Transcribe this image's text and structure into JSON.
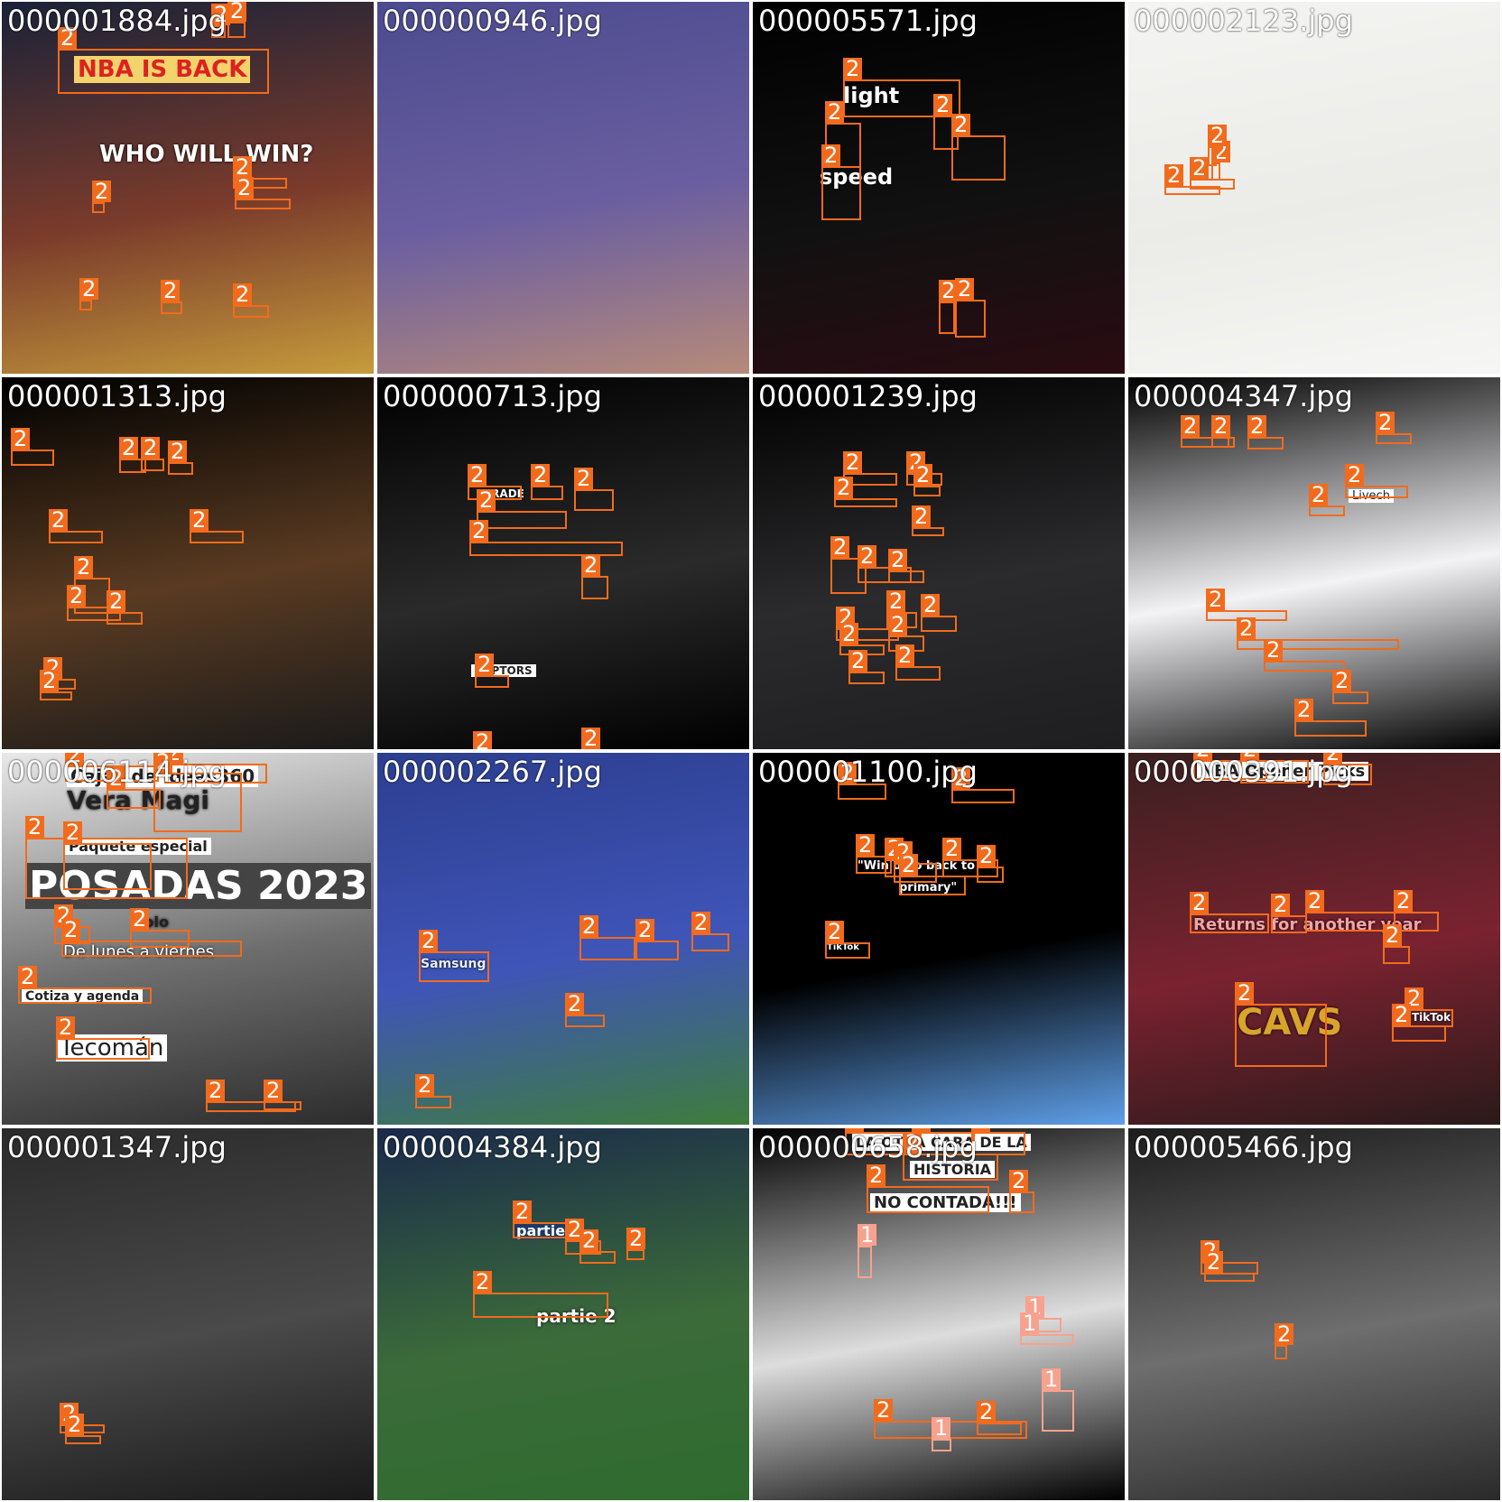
{
  "tiles": [
    {
      "file": "000001884.jpg",
      "bg": [
        "#1b2238",
        "#7a3b2b",
        "#c69b3c"
      ],
      "texts": [
        "NBA IS BACK",
        "WHO WILL WIN?"
      ]
    },
    {
      "file": "000000946.jpg",
      "bg": [
        "#4b4b8f",
        "#6b5fa0",
        "#b68a7a"
      ],
      "texts": []
    },
    {
      "file": "000005571.jpg",
      "bg": [
        "#000000",
        "#111111",
        "#2a0c12"
      ],
      "texts": [
        "light",
        "speed"
      ]
    },
    {
      "file": "000002123.jpg",
      "bg": [
        "#f4f4f2",
        "#ebebe8",
        "#f6f6f4"
      ],
      "texts": []
    },
    {
      "file": "000001313.jpg",
      "bg": [
        "#000000",
        "#5a3b22",
        "#1a1a1a"
      ],
      "texts": []
    },
    {
      "file": "000000713.jpg",
      "bg": [
        "#000000",
        "#2a2a2a",
        "#000000"
      ],
      "texts": [
        "TRADE",
        "RAPTORS"
      ]
    },
    {
      "file": "000001239.jpg",
      "bg": [
        "#000000",
        "#2b2b2d",
        "#1e1e20"
      ],
      "texts": []
    },
    {
      "file": "000004347.jpg",
      "bg": [
        "#000000",
        "#f3f3f6",
        "#000000"
      ],
      "texts": [
        "Livech"
      ]
    },
    {
      "file": "000006114.jpg",
      "bg": [
        "#e9e9e9",
        "#6e6e6e",
        "#2c2c2c"
      ],
      "texts": [
        "Cajas de ideas360",
        "Vera Magi",
        "Paquete especial",
        "POSADAS 2023",
        "Solo",
        "De lunes a viernes",
        "Cotiza y agenda",
        "Tecomán"
      ]
    },
    {
      "file": "000002267.jpg",
      "bg": [
        "#2c3e8f",
        "#3f55b8",
        "#3e7d3c"
      ],
      "texts": [
        "Samsung"
      ]
    },
    {
      "file": "000001100.jpg",
      "bg": [
        "#000000",
        "#000000",
        "#5f9fe8"
      ],
      "texts": [
        "\"Win d go back to",
        "primary\"",
        "TikTok"
      ]
    },
    {
      "file": "000000391.jpg",
      "bg": [
        "#3a2020",
        "#7a2230",
        "#2a1a1a"
      ],
      "texts": [
        "NBA Opener Picks",
        "Returns for another year",
        "CAVS",
        "TikTok"
      ]
    },
    {
      "file": "000001347.jpg",
      "bg": [
        "#2a2a2a",
        "#4a4a4a",
        "#1a1a1a"
      ],
      "texts": []
    },
    {
      "file": "000004384.jpg",
      "bg": [
        "#1a2a4a",
        "#3b6b3a",
        "#2f6b2e"
      ],
      "texts": [
        "partie",
        "partie 2"
      ]
    },
    {
      "file": "000000658.jpg",
      "bg": [
        "#000000",
        "#dddddd",
        "#000000"
      ],
      "texts": [
        "LA OTRA CARA DE LA",
        "HISTORIA",
        "NO CONTADA!!!"
      ]
    },
    {
      "file": "000005466.jpg",
      "bg": [
        "#1c1c1c",
        "#6e6e6e",
        "#2a2a2a"
      ],
      "texts": []
    }
  ],
  "labels": {
    "c2": "2",
    "c1": "1"
  }
}
